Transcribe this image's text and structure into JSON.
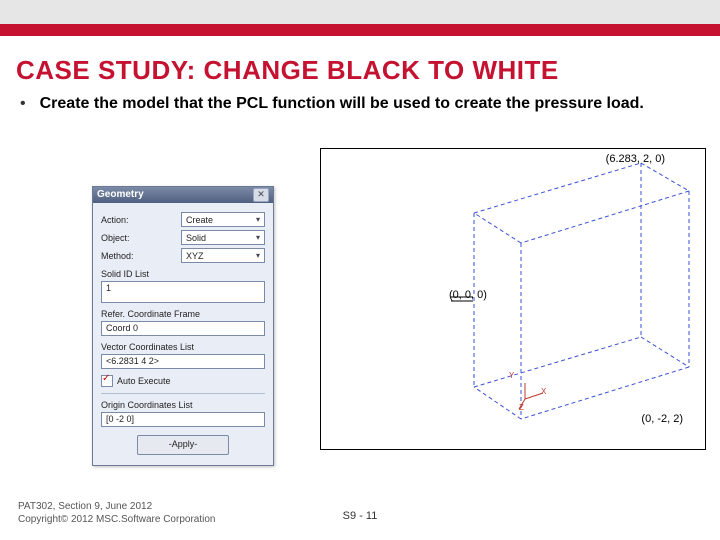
{
  "title": "CASE STUDY: CHANGE BLACK TO WHITE",
  "bullet_text": "Create the model that the PCL function will be used to create the pressure load.",
  "dialog": {
    "title": "Geometry",
    "action_label": "Action:",
    "action_value": "Create",
    "object_label": "Object:",
    "object_value": "Solid",
    "method_label": "Method:",
    "method_value": "XYZ",
    "solid_id_label": "Solid ID List",
    "solid_id_value": "1",
    "coord_frame_label": "Refer. Coordinate Frame",
    "coord_frame_value": "Coord 0",
    "vector_label": "Vector Coordinates List",
    "vector_value": "<6.2831 4 2>",
    "auto_execute_label": "Auto Execute",
    "origin_label": "Origin Coordinates List",
    "origin_value": "[0 -2 0]",
    "apply_label": "-Apply-"
  },
  "view": {
    "pt1": "(6.283, 2, 0)",
    "pt2": "(0, 0, 0)",
    "pt3": "(0, -2, 2)"
  },
  "triad": {
    "x": "X",
    "y": "Y",
    "z": "Z"
  },
  "footer": {
    "line1": "PAT302, Section 9, June 2012",
    "line2": "Copyright© 2012 MSC.Software Corporation"
  },
  "page_number": "S9 - 11"
}
